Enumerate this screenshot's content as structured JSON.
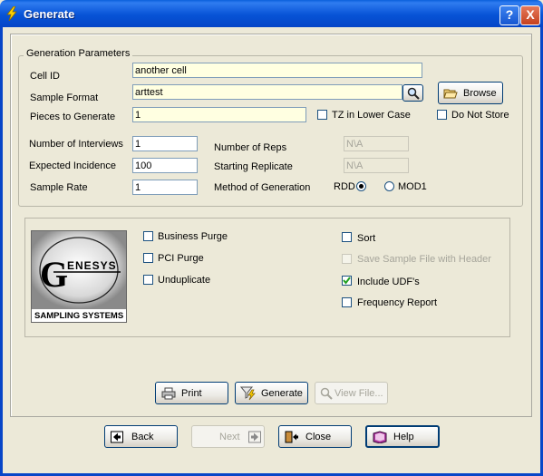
{
  "window": {
    "title": "Generate",
    "help_button": "?",
    "close_button": "X"
  },
  "params": {
    "group_title": "Generation Parameters",
    "cell_id_label": "Cell ID",
    "cell_id_value": "another cell",
    "sample_format_label": "Sample Format",
    "sample_format_value": "arttest",
    "browse_label": "Browse",
    "pieces_label": "Pieces to Generate",
    "pieces_value": "1",
    "tz_label": "TZ  in  Lower  Case",
    "tz_checked": false,
    "do_not_store_label": "Do Not Store",
    "do_not_store_checked": false,
    "interviews_label": "Number of Interviews",
    "interviews_value": "1",
    "incidence_label": "Expected Incidence",
    "incidence_value": "100",
    "rate_label": "Sample Rate",
    "rate_value": "1",
    "reps_label": "Number of Reps",
    "reps_value": "N\\A",
    "replicate_label": "Starting Replicate",
    "replicate_value": "N\\A",
    "method_label": "Method of Generation",
    "method_rdd": "RDD",
    "method_mod1": "MOD1",
    "method_selected": "RDD"
  },
  "logo": {
    "letter": "G",
    "word": "ENESYS",
    "caption": "SAMPLING SYSTEMS"
  },
  "options": {
    "business_purge": {
      "label": "Business Purge",
      "checked": false
    },
    "pci_purge": {
      "label": "PCI Purge",
      "checked": false
    },
    "unduplicate": {
      "label": "Unduplicate",
      "checked": false
    },
    "sort": {
      "label": "Sort",
      "checked": false
    },
    "save_header": {
      "label": "Save Sample File with Header",
      "checked": false
    },
    "include_udf": {
      "label": "Include UDF's",
      "checked": true
    },
    "frequency_report": {
      "label": "Frequency Report",
      "checked": false
    }
  },
  "actions": {
    "print": "Print",
    "generate": "Generate",
    "view_file": "View File..."
  },
  "nav": {
    "back": "Back",
    "next": "Next",
    "close": "Close",
    "help": "Help"
  }
}
